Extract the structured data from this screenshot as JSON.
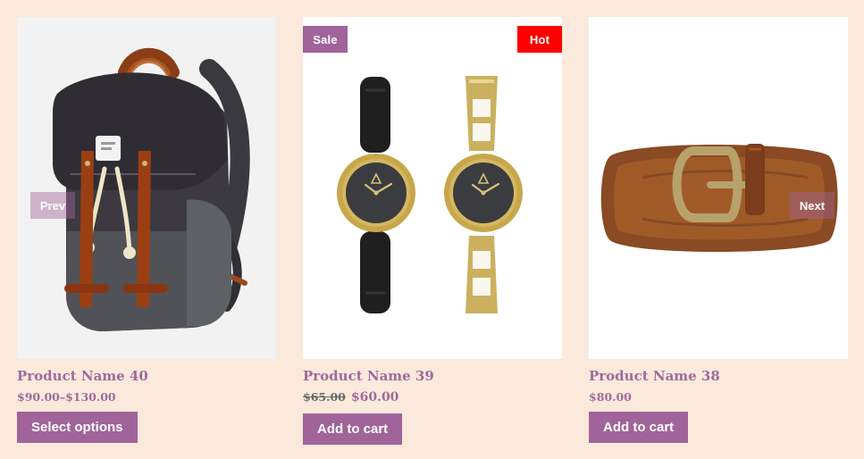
{
  "colors": {
    "page_background": "#fbeadb",
    "accent": "#a0649a",
    "hot": "#ff0000"
  },
  "nav": {
    "prev_label": "Prev",
    "next_label": "Next"
  },
  "products": [
    {
      "title": "Product Name 40",
      "price_range": "$90.00–$130.00",
      "cta_label": "Select options",
      "image_icon": "backpack-icon"
    },
    {
      "title": "Product Name 39",
      "price_old": "$65.00",
      "price_sale": "$60.00",
      "cta_label": "Add to cart",
      "badges": {
        "sale": "Sale",
        "hot": "Hot"
      },
      "image_icon": "watches-icon"
    },
    {
      "title": "Product Name 38",
      "price": "$80.00",
      "cta_label": "Add to cart",
      "image_icon": "belt-icon"
    }
  ]
}
